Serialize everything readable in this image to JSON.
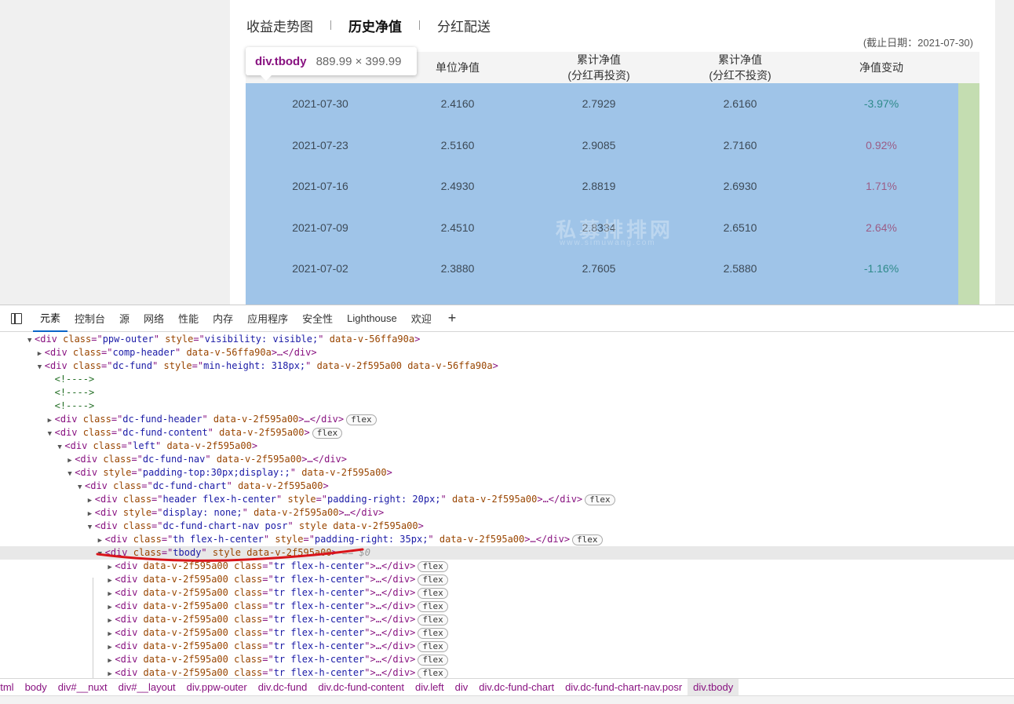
{
  "page": {
    "tabs": [
      "收益走势图",
      "历史净值",
      "分红配送"
    ],
    "active_tab": "历史净值",
    "cutoff_date": "(截止日期：2021-07-30)",
    "headers": [
      {
        "line1": "单位净值",
        "line2": ""
      },
      {
        "line1": "累计净值",
        "line2": "(分红再投资)"
      },
      {
        "line1": "累计净值",
        "line2": "(分红不投资)"
      },
      {
        "line1": "净值变动",
        "line2": ""
      }
    ],
    "rows": [
      {
        "date": "2021-07-30",
        "unit_nav": "2.4160",
        "acc_reinvest": "2.7929",
        "acc_no_reinvest": "2.6160",
        "change": "-3.97%",
        "dir": "neg"
      },
      {
        "date": "2021-07-23",
        "unit_nav": "2.5160",
        "acc_reinvest": "2.9085",
        "acc_no_reinvest": "2.7160",
        "change": "0.92%",
        "dir": "pos"
      },
      {
        "date": "2021-07-16",
        "unit_nav": "2.4930",
        "acc_reinvest": "2.8819",
        "acc_no_reinvest": "2.6930",
        "change": "1.71%",
        "dir": "pos"
      },
      {
        "date": "2021-07-09",
        "unit_nav": "2.4510",
        "acc_reinvest": "2.8334",
        "acc_no_reinvest": "2.6510",
        "change": "2.64%",
        "dir": "pos"
      },
      {
        "date": "2021-07-02",
        "unit_nav": "2.3880",
        "acc_reinvest": "2.7605",
        "acc_no_reinvest": "2.5880",
        "change": "-1.16%",
        "dir": "neg"
      }
    ],
    "watermark": "私募排排网",
    "watermark_sub": "www.simuwang.com"
  },
  "tooltip": {
    "tag": "div.tbody",
    "size": "889.99 × 399.99"
  },
  "devtools": {
    "tabs": [
      "元素",
      "控制台",
      "源",
      "网络",
      "性能",
      "内存",
      "应用程序",
      "安全性",
      "Lighthouse",
      "欢迎"
    ],
    "active_tab": "元素",
    "plus": "+",
    "selected_suffix": "== $0",
    "flex_label": "flex",
    "lines": [
      {
        "indent": 0,
        "caret": "▼",
        "parts": [
          [
            "tag",
            "<div "
          ],
          [
            "attr",
            "class"
          ],
          [
            "tag",
            "=\""
          ],
          [
            "val",
            "ppw-outer"
          ],
          [
            "tag",
            "\" "
          ],
          [
            "attr",
            "style"
          ],
          [
            "tag",
            "=\""
          ],
          [
            "val",
            "visibility: visible;"
          ],
          [
            "tag",
            "\" "
          ],
          [
            "attr",
            "data-v-56ffa90a"
          ],
          [
            "tag",
            ">"
          ]
        ]
      },
      {
        "indent": 1,
        "caret": "▶",
        "parts": [
          [
            "tag",
            "<div "
          ],
          [
            "attr",
            "class"
          ],
          [
            "tag",
            "=\""
          ],
          [
            "val",
            "comp-header"
          ],
          [
            "tag",
            "\" "
          ],
          [
            "attr",
            "data-v-56ffa90a"
          ],
          [
            "tag",
            ">…</div>"
          ]
        ]
      },
      {
        "indent": 1,
        "caret": "▼",
        "parts": [
          [
            "tag",
            "<div "
          ],
          [
            "attr",
            "class"
          ],
          [
            "tag",
            "=\""
          ],
          [
            "val",
            "dc-fund"
          ],
          [
            "tag",
            "\" "
          ],
          [
            "attr",
            "style"
          ],
          [
            "tag",
            "=\""
          ],
          [
            "val",
            "min-height: 318px;"
          ],
          [
            "tag",
            "\" "
          ],
          [
            "attr",
            "data-v-2f595a00 data-v-56ffa90a"
          ],
          [
            "tag",
            ">"
          ]
        ]
      },
      {
        "indent": 2,
        "caret": "",
        "parts": [
          [
            "cmt",
            "<!---->"
          ]
        ]
      },
      {
        "indent": 2,
        "caret": "",
        "parts": [
          [
            "cmt",
            "<!---->"
          ]
        ]
      },
      {
        "indent": 2,
        "caret": "",
        "parts": [
          [
            "cmt",
            "<!---->"
          ]
        ]
      },
      {
        "indent": 2,
        "caret": "▶",
        "flex": true,
        "parts": [
          [
            "tag",
            "<div "
          ],
          [
            "attr",
            "class"
          ],
          [
            "tag",
            "=\""
          ],
          [
            "val",
            "dc-fund-header"
          ],
          [
            "tag",
            "\" "
          ],
          [
            "attr",
            "data-v-2f595a00"
          ],
          [
            "tag",
            ">…</div>"
          ]
        ]
      },
      {
        "indent": 2,
        "caret": "▼",
        "flex": true,
        "parts": [
          [
            "tag",
            "<div "
          ],
          [
            "attr",
            "class"
          ],
          [
            "tag",
            "=\""
          ],
          [
            "val",
            "dc-fund-content"
          ],
          [
            "tag",
            "\" "
          ],
          [
            "attr",
            "data-v-2f595a00"
          ],
          [
            "tag",
            ">"
          ]
        ]
      },
      {
        "indent": 3,
        "caret": "▼",
        "parts": [
          [
            "tag",
            "<div "
          ],
          [
            "attr",
            "class"
          ],
          [
            "tag",
            "=\""
          ],
          [
            "val",
            "left"
          ],
          [
            "tag",
            "\" "
          ],
          [
            "attr",
            "data-v-2f595a00"
          ],
          [
            "tag",
            ">"
          ]
        ]
      },
      {
        "indent": 4,
        "caret": "▶",
        "parts": [
          [
            "tag",
            "<div "
          ],
          [
            "attr",
            "class"
          ],
          [
            "tag",
            "=\""
          ],
          [
            "val",
            "dc-fund-nav"
          ],
          [
            "tag",
            "\" "
          ],
          [
            "attr",
            "data-v-2f595a00"
          ],
          [
            "tag",
            ">…</div>"
          ]
        ]
      },
      {
        "indent": 4,
        "caret": "▼",
        "parts": [
          [
            "tag",
            "<div "
          ],
          [
            "attr",
            "style"
          ],
          [
            "tag",
            "=\""
          ],
          [
            "val",
            "padding-top:30px;display:;"
          ],
          [
            "tag",
            "\" "
          ],
          [
            "attr",
            "data-v-2f595a00"
          ],
          [
            "tag",
            ">"
          ]
        ]
      },
      {
        "indent": 5,
        "caret": "▼",
        "parts": [
          [
            "tag",
            "<div "
          ],
          [
            "attr",
            "class"
          ],
          [
            "tag",
            "=\""
          ],
          [
            "val",
            "dc-fund-chart"
          ],
          [
            "tag",
            "\" "
          ],
          [
            "attr",
            "data-v-2f595a00"
          ],
          [
            "tag",
            ">"
          ]
        ]
      },
      {
        "indent": 6,
        "caret": "▶",
        "flex": true,
        "parts": [
          [
            "tag",
            "<div "
          ],
          [
            "attr",
            "class"
          ],
          [
            "tag",
            "=\""
          ],
          [
            "val",
            "header flex-h-center"
          ],
          [
            "tag",
            "\" "
          ],
          [
            "attr",
            "style"
          ],
          [
            "tag",
            "=\""
          ],
          [
            "val",
            "padding-right: 20px;"
          ],
          [
            "tag",
            "\" "
          ],
          [
            "attr",
            "data-v-2f595a00"
          ],
          [
            "tag",
            ">…</div>"
          ]
        ]
      },
      {
        "indent": 6,
        "caret": "▶",
        "parts": [
          [
            "tag",
            "<div "
          ],
          [
            "attr",
            "style"
          ],
          [
            "tag",
            "=\""
          ],
          [
            "val",
            "display: none;"
          ],
          [
            "tag",
            "\" "
          ],
          [
            "attr",
            "data-v-2f595a00"
          ],
          [
            "tag",
            ">…</div>"
          ]
        ]
      },
      {
        "indent": 6,
        "caret": "▼",
        "parts": [
          [
            "tag",
            "<div "
          ],
          [
            "attr",
            "class"
          ],
          [
            "tag",
            "=\""
          ],
          [
            "val",
            "dc-fund-chart-nav posr"
          ],
          [
            "tag",
            "\" "
          ],
          [
            "attr",
            "style data-v-2f595a00"
          ],
          [
            "tag",
            ">"
          ]
        ]
      },
      {
        "indent": 7,
        "caret": "▶",
        "flex": true,
        "parts": [
          [
            "tag",
            "<div "
          ],
          [
            "attr",
            "class"
          ],
          [
            "tag",
            "=\""
          ],
          [
            "val",
            "th flex-h-center"
          ],
          [
            "tag",
            "\" "
          ],
          [
            "attr",
            "style"
          ],
          [
            "tag",
            "=\""
          ],
          [
            "val",
            "padding-right: 35px;"
          ],
          [
            "tag",
            "\" "
          ],
          [
            "attr",
            "data-v-2f595a00"
          ],
          [
            "tag",
            ">…</div>"
          ]
        ]
      },
      {
        "indent": 7,
        "caret": "▼",
        "selected": true,
        "parts": [
          [
            "tag",
            "<div "
          ],
          [
            "attr",
            "class"
          ],
          [
            "tag",
            "=\""
          ],
          [
            "val",
            "tbody"
          ],
          [
            "tag",
            "\" "
          ],
          [
            "attr",
            "style data-v-2f595a00"
          ],
          [
            "tag",
            ">"
          ]
        ]
      },
      {
        "indent": 8,
        "caret": "▶",
        "flex": true,
        "parts": [
          [
            "tag",
            "<div "
          ],
          [
            "attr",
            "data-v-2f595a00 class"
          ],
          [
            "tag",
            "=\""
          ],
          [
            "val",
            "tr flex-h-center"
          ],
          [
            "tag",
            "\">…</div>"
          ]
        ]
      },
      {
        "indent": 8,
        "caret": "▶",
        "flex": true,
        "parts": [
          [
            "tag",
            "<div "
          ],
          [
            "attr",
            "data-v-2f595a00 class"
          ],
          [
            "tag",
            "=\""
          ],
          [
            "val",
            "tr flex-h-center"
          ],
          [
            "tag",
            "\">…</div>"
          ]
        ]
      },
      {
        "indent": 8,
        "caret": "▶",
        "flex": true,
        "parts": [
          [
            "tag",
            "<div "
          ],
          [
            "attr",
            "data-v-2f595a00 class"
          ],
          [
            "tag",
            "=\""
          ],
          [
            "val",
            "tr flex-h-center"
          ],
          [
            "tag",
            "\">…</div>"
          ]
        ]
      },
      {
        "indent": 8,
        "caret": "▶",
        "flex": true,
        "parts": [
          [
            "tag",
            "<div "
          ],
          [
            "attr",
            "data-v-2f595a00 class"
          ],
          [
            "tag",
            "=\""
          ],
          [
            "val",
            "tr flex-h-center"
          ],
          [
            "tag",
            "\">…</div>"
          ]
        ]
      },
      {
        "indent": 8,
        "caret": "▶",
        "flex": true,
        "parts": [
          [
            "tag",
            "<div "
          ],
          [
            "attr",
            "data-v-2f595a00 class"
          ],
          [
            "tag",
            "=\""
          ],
          [
            "val",
            "tr flex-h-center"
          ],
          [
            "tag",
            "\">…</div>"
          ]
        ]
      },
      {
        "indent": 8,
        "caret": "▶",
        "flex": true,
        "parts": [
          [
            "tag",
            "<div "
          ],
          [
            "attr",
            "data-v-2f595a00 class"
          ],
          [
            "tag",
            "=\""
          ],
          [
            "val",
            "tr flex-h-center"
          ],
          [
            "tag",
            "\">…</div>"
          ]
        ]
      },
      {
        "indent": 8,
        "caret": "▶",
        "flex": true,
        "parts": [
          [
            "tag",
            "<div "
          ],
          [
            "attr",
            "data-v-2f595a00 class"
          ],
          [
            "tag",
            "=\""
          ],
          [
            "val",
            "tr flex-h-center"
          ],
          [
            "tag",
            "\">…</div>"
          ]
        ]
      },
      {
        "indent": 8,
        "caret": "▶",
        "flex": true,
        "parts": [
          [
            "tag",
            "<div "
          ],
          [
            "attr",
            "data-v-2f595a00 class"
          ],
          [
            "tag",
            "=\""
          ],
          [
            "val",
            "tr flex-h-center"
          ],
          [
            "tag",
            "\">…</div>"
          ]
        ]
      },
      {
        "indent": 8,
        "caret": "▶",
        "flex": true,
        "parts": [
          [
            "tag",
            "<div "
          ],
          [
            "attr",
            "data-v-2f595a00 class"
          ],
          [
            "tag",
            "=\""
          ],
          [
            "val",
            "tr flex-h-center"
          ],
          [
            "tag",
            "\">…</div>"
          ]
        ]
      }
    ],
    "breadcrumbs": [
      "html",
      "body",
      "div#__nuxt",
      "div#__layout",
      "div.ppw-outer",
      "div.dc-fund",
      "div.dc-fund-content",
      "div.left",
      "div",
      "div.dc-fund-chart",
      "div.dc-fund-chart-nav.posr",
      "div.tbody"
    ],
    "active_breadcrumb": "div.tbody",
    "annotation_color": "#d9141a"
  }
}
